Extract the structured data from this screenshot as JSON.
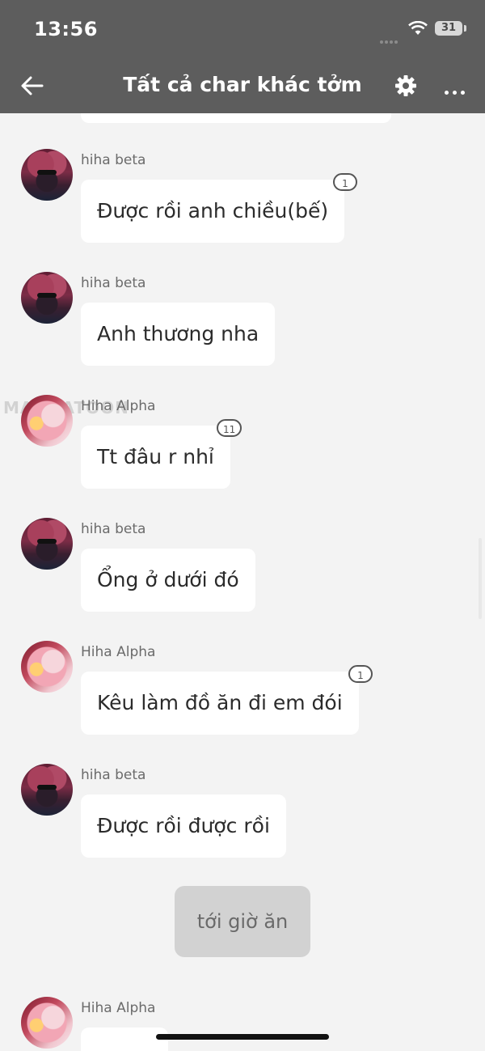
{
  "status_bar": {
    "time": "13:56",
    "battery": "31"
  },
  "header": {
    "title": "Tất cả char khác tởm"
  },
  "messages": [
    {
      "sender": "hiha beta",
      "text": "Được rồi anh chiều(bế)",
      "replies": "1"
    },
    {
      "sender": "hiha beta",
      "text": "Anh thương nha"
    },
    {
      "sender": "Hiha Alpha",
      "text": "Tt đâu r nhỉ",
      "replies": "11"
    },
    {
      "sender": "hiha beta",
      "text": "Ổng ở dưới đó"
    },
    {
      "sender": "Hiha Alpha",
      "text": "Kêu làm đồ ăn đi em đói",
      "replies": "1"
    },
    {
      "sender": "hiha beta",
      "text": "Được rồi được rồi"
    },
    {
      "sender": "Hiha Alpha",
      "text": ""
    }
  ],
  "system_message": {
    "text": "tới giờ ăn"
  },
  "watermark": "MANGATOON",
  "colors": {
    "header_bg": "#5d5d5d",
    "chat_bg": "#f3f3f3",
    "bubble_bg": "#ffffff",
    "system_bg": "#d2d2d2"
  }
}
